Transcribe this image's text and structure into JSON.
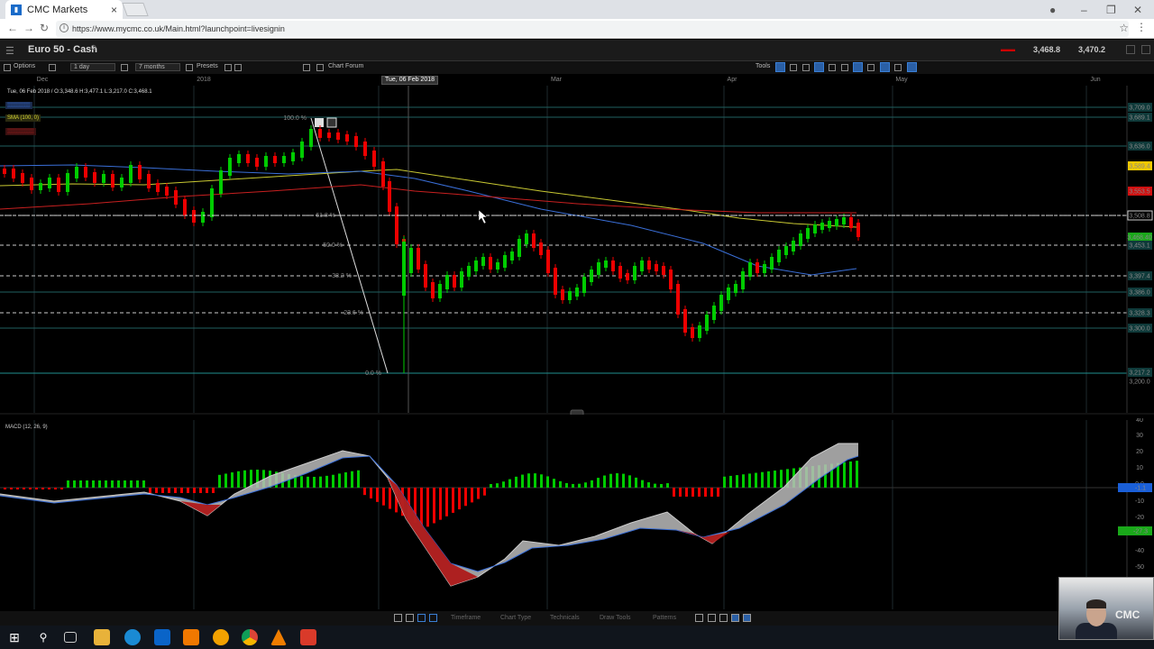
{
  "browser": {
    "tab_title": "CMC Markets",
    "tab_close": "×",
    "url": "https://www.mycmc.co.uk/Main.html?launchpoint=livesignin"
  },
  "app": {
    "instrument": "Euro 50 - Cash",
    "sell_price": "3,468.8",
    "buy_price": "3,470.2"
  },
  "toolbar": {
    "options_label": "Options",
    "interval": "1 day",
    "range": "7 months",
    "presets_label": "Presets",
    "chart_forum_label": "Chart Forum",
    "tools_label": "Tools"
  },
  "chart": {
    "ohlc_line": "Tue, 06 Feb 2018 / O:3,348.6 H:3,477.1 L:3,217.0 C:3,468.1",
    "sma_label": "SMA (100, 0)",
    "hover_date": "Tue, 06 Feb 2018",
    "x_ticks": [
      "Dec",
      "2018",
      "Mar",
      "Apr",
      "May",
      "Jun"
    ],
    "price_labels": [
      "3,709.0",
      "3,689.1",
      "3,636.0",
      "3,589.4",
      "3,553.5",
      "3,508.8",
      "3,468.40",
      "3,453.1",
      "3,397.4",
      "3,386.0",
      "3,328.3",
      "3,300.0",
      "3,217.2",
      "3,200.0"
    ],
    "fib_levels": [
      "100.0 %",
      "61.8 %",
      "50.0 %",
      "38.2 %",
      "23.6 %",
      "0.0 %"
    ],
    "colors": {
      "up": "#00cc00",
      "down": "#ee0000",
      "sma_yellow": "#c8c832",
      "sma_blue": "#3a6fd8",
      "sma_red": "#c82020"
    }
  },
  "macd": {
    "label": "MACD (12, 26, 9)",
    "y_ticks": [
      "40",
      "30",
      "20",
      "10",
      "0.0",
      "-10",
      "-20",
      "-30",
      "-40",
      "-50"
    ],
    "macd_value": "-1.1",
    "signal_value": "-27.3"
  },
  "bottombar": {
    "timeframe": "Timeframe",
    "chart_type": "Chart Type",
    "technicals": "Technicals",
    "draw_tools": "Draw Tools",
    "patterns": "Patterns"
  }
}
